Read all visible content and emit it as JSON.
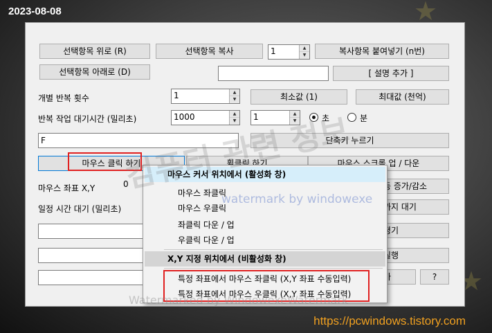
{
  "date": "2023-08-08",
  "url": "https://pcwindows.tistory.com",
  "watermarks": {
    "main": "컴퓨터 관련 정보",
    "sub": "watermark by windowexe",
    "sub2": "Watermarked by WindowexeWatermark"
  },
  "buttons": {
    "move_up": "선택항목 위로 (R)",
    "copy": "선택항목 복사",
    "paste_n": "복사항목 붙여넣기 (n번)",
    "move_down": "선택항목 아래로 (D)",
    "add_desc": "[ 설명 추가 ]",
    "min_value": "최소값 (1)",
    "max_value": "최대값 (천억)",
    "shortcut": "단축키 누르기",
    "mouse_click": "마우스 클릭 하기",
    "wheel_click": "휠클릭 하기",
    "mouse_scroll": "마우스 스크롤 업 / 다운",
    "auto_inc": "동 증가/감소",
    "wait_until": "까지 대기",
    "btn_r5": "평기",
    "btn_r6": "실행",
    "btn_r7": "가",
    "help": "?"
  },
  "labels": {
    "repeat_count": "개별 반복 횟수",
    "repeat_wait": "반복 작업 대기시간 (밀리초)",
    "mouse_coord": "마우스 좌표 X,Y",
    "wait_time": "일정 시간 대기 (밀리초)",
    "sec": "초",
    "min": "분"
  },
  "inputs": {
    "copy_count": "1",
    "repeat_count": "1",
    "wait_ms": "1000",
    "wait_unit_value": "1",
    "shortcut_text": "F",
    "mouse_x": "0"
  },
  "menu": {
    "header_active": "마우스 커서 위치에서 (활성화 창)",
    "items_active": [
      "마우스 좌클릭",
      "마우스 우클릭",
      "좌클릭 다운 / 업",
      "우클릭 다운 / 업"
    ],
    "header_inactive": "X,Y 지정 위치에서 (비활성화 창)",
    "items_inactive": [
      "특정 좌표에서 마우스 좌클릭 (X,Y 좌표 수동입력)",
      "특정 좌표에서 마우스 우클릭 (X,Y 좌표 수동입력)"
    ]
  },
  "colors": {
    "highlight_box": "#e02020",
    "menu_header_active": "#d6eefa",
    "url_text": "#f0a020"
  }
}
